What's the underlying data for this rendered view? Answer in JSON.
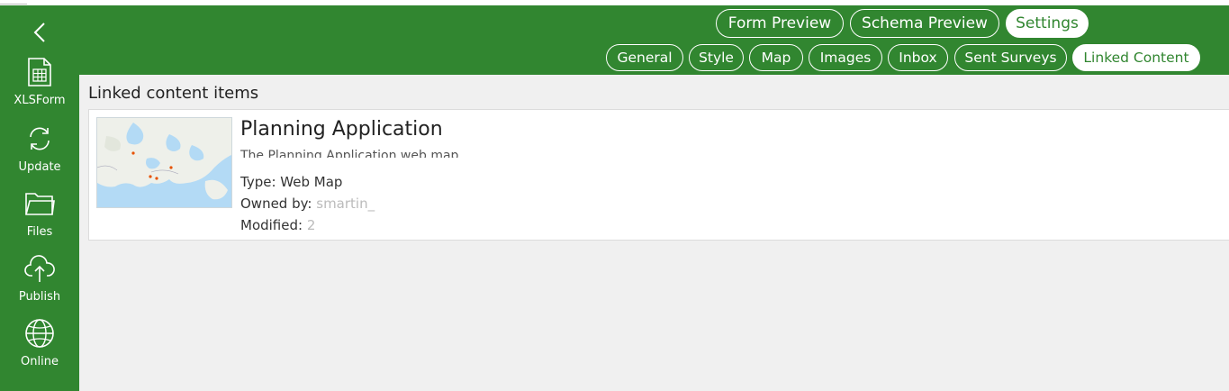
{
  "sidebar": {
    "back_icon": "chevron-left-icon",
    "items": [
      {
        "label": "XLSForm",
        "icon": "spreadsheet-icon"
      },
      {
        "label": "Update",
        "icon": "refresh-icon"
      },
      {
        "label": "Files",
        "icon": "folder-icon"
      },
      {
        "label": "Publish",
        "icon": "cloud-upload-icon"
      },
      {
        "label": "Online",
        "icon": "globe-icon"
      }
    ]
  },
  "header": {
    "main_tabs": [
      {
        "label": "Form Preview",
        "active": false
      },
      {
        "label": "Schema Preview",
        "active": false
      },
      {
        "label": "Settings",
        "active": true
      }
    ],
    "sub_tabs": [
      {
        "label": "General",
        "active": false
      },
      {
        "label": "Style",
        "active": false
      },
      {
        "label": "Map",
        "active": false
      },
      {
        "label": "Images",
        "active": false
      },
      {
        "label": "Inbox",
        "active": false
      },
      {
        "label": "Sent Surveys",
        "active": false
      },
      {
        "label": "Linked Content",
        "active": true
      }
    ]
  },
  "content": {
    "section_title": "Linked content items",
    "item": {
      "title": "Planning Application",
      "description": "The Planning Application web map ...",
      "type_label": "Type: Web Map",
      "owner_label": "Owned by:",
      "owner_value": "smartin_",
      "modified_label": "Modified:",
      "modified_value": "2"
    }
  },
  "colors": {
    "brand_green": "#318630",
    "content_bg": "#f0f0f0",
    "map_water": "#b3daf5",
    "map_land": "#eef0ea",
    "marker": "#e65100"
  }
}
